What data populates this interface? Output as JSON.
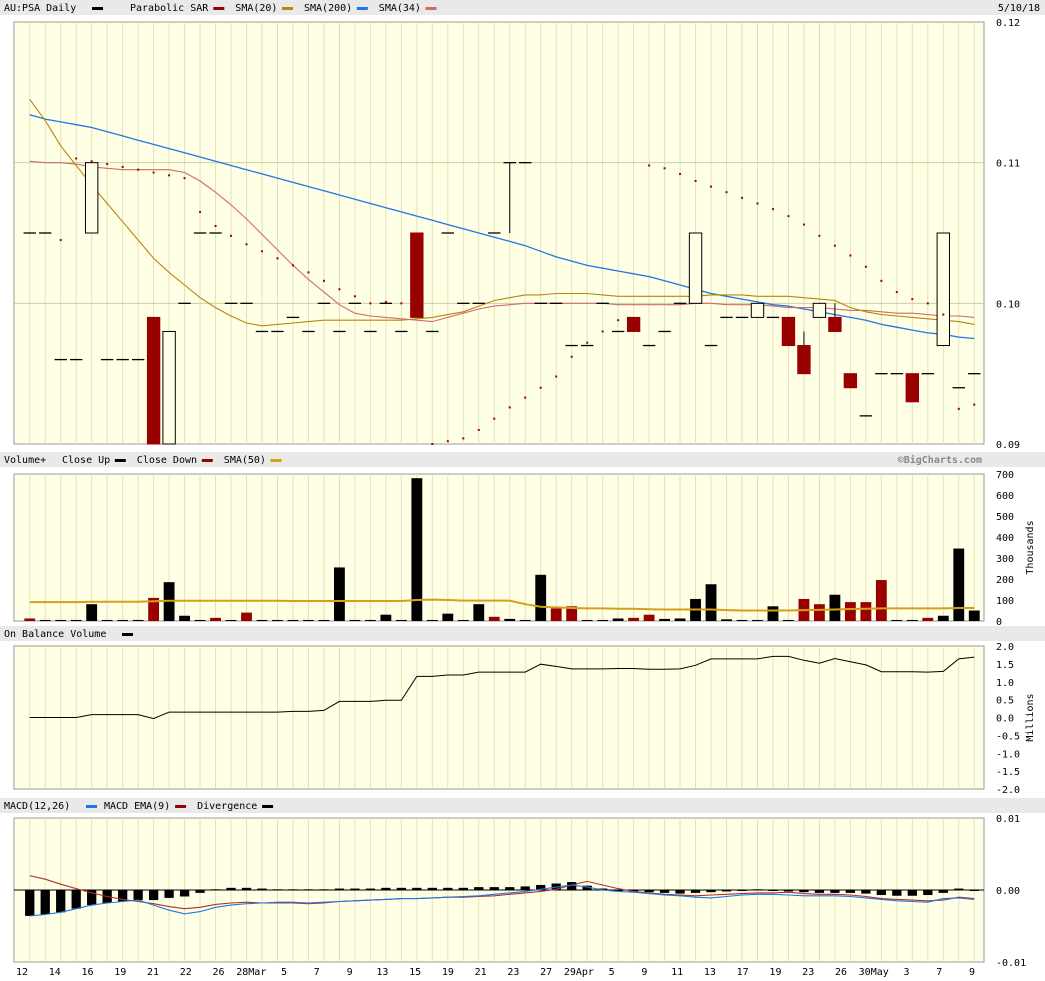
{
  "header": {
    "symbol": "AU:PSA Daily",
    "date": "5/10/18",
    "watermark": "©BigCharts.com"
  },
  "colors": {
    "panel_bg": "#ffffe6",
    "grid": "#e2e2b8",
    "up": "#000000",
    "down": "#990000",
    "sma20": "#b8860b",
    "sma200": "#1f77e6",
    "sma34": "#d06b6b",
    "volsma": "#d4a017"
  },
  "chart_data": [
    {
      "type": "candlestick",
      "title": "AU:PSA Daily",
      "legend": [
        {
          "name": "Parabolic SAR",
          "color": "#990000"
        },
        {
          "name": "SMA(20)",
          "color": "#b8860b"
        },
        {
          "name": "SMA(200)",
          "color": "#1f77e6"
        },
        {
          "name": "SMA(34)",
          "color": "#d06b6b"
        }
      ],
      "ylim": [
        0.09,
        0.12
      ],
      "yticks": [
        "0.12",
        "0.11",
        "0.10",
        "0.09"
      ],
      "x_tick_labels": [
        "12",
        "14",
        "16",
        "19",
        "21",
        "22",
        "26",
        "28Mar",
        "5",
        "7",
        "9",
        "13",
        "15",
        "19",
        "21",
        "23",
        "27",
        "29Apr",
        "5",
        "9",
        "11",
        "13",
        "17",
        "19",
        "23",
        "26",
        "30May",
        "3",
        "7",
        "9"
      ],
      "candles": [
        {
          "o": 0.105,
          "h": 0.105,
          "l": 0.105,
          "c": 0.105
        },
        {
          "o": 0.105,
          "h": 0.105,
          "l": 0.105,
          "c": 0.105
        },
        {
          "o": 0.096,
          "h": 0.096,
          "l": 0.096,
          "c": 0.096
        },
        {
          "o": 0.096,
          "h": 0.096,
          "l": 0.096,
          "c": 0.096
        },
        {
          "o": 0.105,
          "h": 0.11,
          "l": 0.105,
          "c": 0.11
        },
        {
          "o": 0.096,
          "h": 0.096,
          "l": 0.096,
          "c": 0.096
        },
        {
          "o": 0.096,
          "h": 0.096,
          "l": 0.096,
          "c": 0.096
        },
        {
          "o": 0.096,
          "h": 0.096,
          "l": 0.096,
          "c": 0.096
        },
        {
          "o": 0.099,
          "h": 0.099,
          "l": 0.09,
          "c": 0.09
        },
        {
          "o": 0.09,
          "h": 0.098,
          "l": 0.09,
          "c": 0.098
        },
        {
          "o": 0.1,
          "h": 0.1,
          "l": 0.1,
          "c": 0.1
        },
        {
          "o": 0.105,
          "h": 0.105,
          "l": 0.105,
          "c": 0.105
        },
        {
          "o": 0.105,
          "h": 0.105,
          "l": 0.105,
          "c": 0.105
        },
        {
          "o": 0.1,
          "h": 0.1,
          "l": 0.1,
          "c": 0.1
        },
        {
          "o": 0.1,
          "h": 0.1,
          "l": 0.1,
          "c": 0.1
        },
        {
          "o": 0.098,
          "h": 0.098,
          "l": 0.098,
          "c": 0.098
        },
        {
          "o": 0.098,
          "h": 0.098,
          "l": 0.098,
          "c": 0.098
        },
        {
          "o": 0.099,
          "h": 0.099,
          "l": 0.099,
          "c": 0.099
        },
        {
          "o": 0.098,
          "h": 0.098,
          "l": 0.098,
          "c": 0.098
        },
        {
          "o": 0.1,
          "h": 0.1,
          "l": 0.1,
          "c": 0.1
        },
        {
          "o": 0.098,
          "h": 0.098,
          "l": 0.098,
          "c": 0.098
        },
        {
          "o": 0.1,
          "h": 0.1,
          "l": 0.1,
          "c": 0.1
        },
        {
          "o": 0.098,
          "h": 0.098,
          "l": 0.098,
          "c": 0.098
        },
        {
          "o": 0.1,
          "h": 0.1,
          "l": 0.1,
          "c": 0.1
        },
        {
          "o": 0.098,
          "h": 0.098,
          "l": 0.098,
          "c": 0.098
        },
        {
          "o": 0.105,
          "h": 0.105,
          "l": 0.099,
          "c": 0.099
        },
        {
          "o": 0.098,
          "h": 0.098,
          "l": 0.098,
          "c": 0.098
        },
        {
          "o": 0.105,
          "h": 0.105,
          "l": 0.105,
          "c": 0.105
        },
        {
          "o": 0.1,
          "h": 0.1,
          "l": 0.1,
          "c": 0.1
        },
        {
          "o": 0.1,
          "h": 0.1,
          "l": 0.1,
          "c": 0.1
        },
        {
          "o": 0.105,
          "h": 0.105,
          "l": 0.105,
          "c": 0.105
        },
        {
          "o": 0.11,
          "h": 0.11,
          "l": 0.105,
          "c": 0.11
        },
        {
          "o": 0.11,
          "h": 0.11,
          "l": 0.11,
          "c": 0.11
        },
        {
          "o": 0.1,
          "h": 0.1,
          "l": 0.1,
          "c": 0.1
        },
        {
          "o": 0.1,
          "h": 0.1,
          "l": 0.1,
          "c": 0.1
        },
        {
          "o": 0.097,
          "h": 0.097,
          "l": 0.097,
          "c": 0.097
        },
        {
          "o": 0.097,
          "h": 0.097,
          "l": 0.097,
          "c": 0.097
        },
        {
          "o": 0.1,
          "h": 0.1,
          "l": 0.1,
          "c": 0.1
        },
        {
          "o": 0.098,
          "h": 0.098,
          "l": 0.098,
          "c": 0.098
        },
        {
          "o": 0.099,
          "h": 0.099,
          "l": 0.098,
          "c": 0.098
        },
        {
          "o": 0.097,
          "h": 0.097,
          "l": 0.097,
          "c": 0.097
        },
        {
          "o": 0.098,
          "h": 0.098,
          "l": 0.098,
          "c": 0.098
        },
        {
          "o": 0.1,
          "h": 0.1,
          "l": 0.1,
          "c": 0.1
        },
        {
          "o": 0.1,
          "h": 0.105,
          "l": 0.1,
          "c": 0.105
        },
        {
          "o": 0.097,
          "h": 0.097,
          "l": 0.097,
          "c": 0.097
        },
        {
          "o": 0.099,
          "h": 0.099,
          "l": 0.099,
          "c": 0.099
        },
        {
          "o": 0.099,
          "h": 0.099,
          "l": 0.099,
          "c": 0.099
        },
        {
          "o": 0.099,
          "h": 0.1,
          "l": 0.099,
          "c": 0.1
        },
        {
          "o": 0.099,
          "h": 0.099,
          "l": 0.099,
          "c": 0.099
        },
        {
          "o": 0.099,
          "h": 0.099,
          "l": 0.097,
          "c": 0.097
        },
        {
          "o": 0.097,
          "h": 0.098,
          "l": 0.095,
          "c": 0.095
        },
        {
          "o": 0.099,
          "h": 0.1,
          "l": 0.099,
          "c": 0.1
        },
        {
          "o": 0.099,
          "h": 0.1,
          "l": 0.098,
          "c": 0.098
        },
        {
          "o": 0.095,
          "h": 0.095,
          "l": 0.094,
          "c": 0.094
        },
        {
          "o": 0.092,
          "h": 0.092,
          "l": 0.092,
          "c": 0.092
        },
        {
          "o": 0.095,
          "h": 0.095,
          "l": 0.095,
          "c": 0.095
        },
        {
          "o": 0.095,
          "h": 0.095,
          "l": 0.095,
          "c": 0.095
        },
        {
          "o": 0.095,
          "h": 0.095,
          "l": 0.093,
          "c": 0.093
        },
        {
          "o": 0.095,
          "h": 0.095,
          "l": 0.095,
          "c": 0.095
        },
        {
          "o": 0.097,
          "h": 0.105,
          "l": 0.097,
          "c": 0.105
        },
        {
          "o": 0.094,
          "h": 0.094,
          "l": 0.094,
          "c": 0.094
        },
        {
          "o": 0.095,
          "h": 0.095,
          "l": 0.095,
          "c": 0.095
        }
      ],
      "sar": [
        null,
        null,
        0.1045,
        0.1103,
        0.1101,
        0.1099,
        0.1097,
        0.1095,
        0.1093,
        0.1091,
        0.1089,
        0.1065,
        0.1055,
        0.1048,
        0.1042,
        0.1037,
        0.1032,
        0.1027,
        0.1022,
        0.1016,
        0.101,
        0.1005,
        0.1,
        0.1001,
        0.1,
        null,
        0.09,
        0.0902,
        0.0904,
        0.091,
        0.0918,
        0.0926,
        0.0933,
        0.094,
        0.0948,
        0.0962,
        0.0972,
        0.098,
        0.0988,
        null,
        0.1098,
        0.1096,
        0.1092,
        0.1087,
        0.1083,
        0.1079,
        0.1075,
        0.1071,
        0.1067,
        0.1062,
        0.1056,
        0.1048,
        0.1041,
        0.1034,
        0.1026,
        0.1016,
        0.1008,
        0.1003,
        0.1,
        0.0992,
        0.0925,
        0.0928
      ],
      "sma200": [
        0.1134,
        0.1131,
        0.1129,
        0.1127,
        0.1125,
        0.1122,
        0.1119,
        0.1116,
        0.1113,
        0.111,
        0.1107,
        0.1104,
        0.1101,
        0.1098,
        0.1095,
        0.1092,
        0.1089,
        0.1086,
        0.1083,
        0.108,
        0.1077,
        0.1074,
        0.1071,
        0.1068,
        0.1065,
        0.1062,
        0.1059,
        0.1056,
        0.1053,
        0.105,
        0.1047,
        0.1044,
        0.1041,
        0.1037,
        0.1033,
        0.103,
        0.1027,
        0.1025,
        0.1023,
        0.1021,
        0.1019,
        0.1016,
        0.1013,
        0.101,
        0.1007,
        0.1005,
        0.1003,
        0.1001,
        0.0999,
        0.0998,
        0.0996,
        0.0994,
        0.0992,
        0.099,
        0.0988,
        0.0985,
        0.0983,
        0.0981,
        0.0979,
        0.0978,
        0.0976,
        0.0975
      ],
      "sma20": [
        0.1145,
        0.113,
        0.1112,
        0.1098,
        0.1084,
        0.1071,
        0.1058,
        0.1045,
        0.1032,
        0.1022,
        0.1013,
        0.1004,
        0.0997,
        0.0991,
        0.0986,
        0.0984,
        0.0985,
        0.0986,
        0.0987,
        0.0988,
        0.0988,
        0.0988,
        0.0988,
        0.0988,
        0.0988,
        0.0989,
        0.099,
        0.0992,
        0.0994,
        0.0998,
        0.1002,
        0.1004,
        0.1006,
        0.1006,
        0.1007,
        0.1007,
        0.1007,
        0.1006,
        0.1005,
        0.1005,
        0.1005,
        0.1005,
        0.1005,
        0.1005,
        0.1006,
        0.1006,
        0.1006,
        0.1005,
        0.1005,
        0.1005,
        0.1004,
        0.1003,
        0.1002,
        0.0997,
        0.0994,
        0.0992,
        0.0991,
        0.099,
        0.0989,
        0.0988,
        0.0987,
        0.0985
      ],
      "sma34": [
        0.1101,
        0.11,
        0.11,
        0.1099,
        0.1097,
        0.1096,
        0.1095,
        0.1095,
        0.1095,
        0.1095,
        0.1093,
        0.1087,
        0.1079,
        0.107,
        0.106,
        0.1049,
        0.1038,
        0.1027,
        0.1017,
        0.1008,
        0.0999,
        0.0993,
        0.0991,
        0.099,
        0.0989,
        0.0988,
        0.0987,
        0.099,
        0.0993,
        0.0996,
        0.0998,
        0.0999,
        0.1,
        0.1,
        0.1,
        0.1,
        0.1,
        0.1,
        0.0999,
        0.0999,
        0.0999,
        0.0999,
        0.0999,
        0.1,
        0.1,
        0.0999,
        0.0999,
        0.0999,
        0.0998,
        0.0997,
        0.0997,
        0.0997,
        0.0996,
        0.0995,
        0.0995,
        0.0994,
        0.0993,
        0.0993,
        0.0992,
        0.0991,
        0.0991,
        0.099
      ]
    },
    {
      "type": "bar",
      "title": "Volume+",
      "legend": [
        {
          "name": "Close Up",
          "color": "#000000"
        },
        {
          "name": "Close Down",
          "color": "#990000"
        },
        {
          "name": "SMA(50)",
          "color": "#d4a017"
        }
      ],
      "ylabel": "Thousands",
      "ylim": [
        0,
        700
      ],
      "yticks": [
        "700",
        "600",
        "500",
        "400",
        "300",
        "200",
        "100",
        "0"
      ],
      "values": [
        12,
        5,
        5,
        5,
        80,
        5,
        5,
        5,
        110,
        185,
        25,
        5,
        15,
        5,
        40,
        5,
        5,
        5,
        5,
        5,
        255,
        5,
        5,
        30,
        5,
        680,
        5,
        35,
        5,
        80,
        20,
        10,
        5,
        220,
        60,
        70,
        5,
        5,
        12,
        15,
        30,
        10,
        12,
        105,
        175,
        8,
        5,
        5,
        70,
        5,
        105,
        80,
        125,
        90,
        90,
        195,
        5,
        5,
        15,
        25,
        345,
        50
      ],
      "down": [
        1,
        0,
        0,
        0,
        0,
        0,
        0,
        0,
        1,
        0,
        0,
        0,
        1,
        0,
        1,
        0,
        0,
        0,
        0,
        0,
        0,
        0,
        0,
        0,
        0,
        0,
        0,
        0,
        0,
        0,
        1,
        0,
        0,
        0,
        1,
        1,
        0,
        0,
        0,
        1,
        1,
        0,
        0,
        0,
        0,
        0,
        0,
        0,
        0,
        0,
        1,
        1,
        0,
        1,
        1,
        1,
        0,
        0,
        1,
        0,
        0,
        0
      ],
      "sma": [
        90,
        90,
        90,
        90,
        92,
        92,
        92,
        92,
        94,
        96,
        96,
        96,
        96,
        96,
        96,
        96,
        96,
        95,
        95,
        95,
        95,
        95,
        95,
        95,
        95,
        100,
        102,
        100,
        97,
        97,
        97,
        97,
        80,
        68,
        65,
        62,
        60,
        60,
        58,
        58,
        56,
        55,
        55,
        55,
        55,
        52,
        50,
        50,
        50,
        50,
        52,
        53,
        55,
        57,
        58,
        60,
        60,
        60,
        60,
        60,
        62,
        62
      ]
    },
    {
      "type": "line",
      "title": "On Balance Volume",
      "ylabel": "Millions",
      "ylim": [
        -2.0,
        2.0
      ],
      "yticks": [
        "2.0",
        "1.5",
        "1.0",
        "0.5",
        "0.0",
        "-0.5",
        "-1.0",
        "-1.5",
        "-2.0"
      ],
      "values": [
        0.0,
        0.0,
        0.0,
        0.0,
        0.08,
        0.08,
        0.08,
        0.08,
        -0.03,
        0.15,
        0.15,
        0.15,
        0.15,
        0.15,
        0.15,
        0.15,
        0.15,
        0.17,
        0.17,
        0.2,
        0.45,
        0.45,
        0.45,
        0.48,
        0.48,
        1.15,
        1.15,
        1.19,
        1.19,
        1.27,
        1.27,
        1.27,
        1.27,
        1.49,
        1.43,
        1.36,
        1.36,
        1.36,
        1.37,
        1.37,
        1.35,
        1.35,
        1.36,
        1.46,
        1.64,
        1.64,
        1.64,
        1.64,
        1.71,
        1.71,
        1.6,
        1.52,
        1.65,
        1.56,
        1.47,
        1.28,
        1.28,
        1.28,
        1.27,
        1.29,
        1.64,
        1.69
      ]
    },
    {
      "type": "bar",
      "title": "MACD(12,26)",
      "legend": [
        {
          "name": "MACD EMA(9)",
          "color": "#1f77e6"
        },
        {
          "name": "Divergence",
          "color": "#000000"
        }
      ],
      "ylim": [
        -0.01,
        0.01
      ],
      "yticks": [
        "0.01",
        "0.00",
        "-0.01"
      ],
      "divergence": [
        -0.0036,
        -0.0034,
        -0.0031,
        -0.0026,
        -0.0021,
        -0.0018,
        -0.0016,
        -0.0014,
        -0.0014,
        -0.0011,
        -0.0009,
        -0.0004,
        0.0001,
        0.0003,
        0.0003,
        0.0002,
        0.0001,
        0.0001,
        0.0001,
        0.0001,
        0.0002,
        0.0002,
        0.0002,
        0.0003,
        0.0003,
        0.0003,
        0.0003,
        0.0003,
        0.0003,
        0.0004,
        0.0004,
        0.0004,
        0.0005,
        0.0007,
        0.0009,
        0.0011,
        0.0006,
        0.0002,
        -0.0001,
        -0.0002,
        -0.0003,
        -0.0004,
        -0.0005,
        -0.0004,
        -0.0003,
        -0.0002,
        -0.0001,
        0.0001,
        -0.0001,
        -0.0002,
        -0.0003,
        -0.0004,
        -0.0004,
        -0.0004,
        -0.0005,
        -0.0007,
        -0.0008,
        -0.0008,
        -0.0007,
        -0.0004,
        0.0002,
        -0.0001
      ],
      "macd": [
        0.002,
        0.0015,
        0.0008,
        0.0002,
        -0.0004,
        -0.0009,
        -0.0013,
        -0.0016,
        -0.0019,
        -0.0023,
        -0.0026,
        -0.0024,
        -0.002,
        -0.0018,
        -0.0017,
        -0.0018,
        -0.0018,
        -0.0018,
        -0.0019,
        -0.0018,
        -0.0016,
        -0.0015,
        -0.0014,
        -0.0013,
        -0.0012,
        -0.0012,
        -0.0011,
        -0.001,
        -0.001,
        -0.0009,
        -0.0008,
        -0.0006,
        -0.0004,
        -0.0002,
        0.0001,
        0.0007,
        0.0012,
        0.0007,
        0.0002,
        -0.0002,
        -0.0004,
        -0.0006,
        -0.0007,
        -0.0008,
        -0.0007,
        -0.0006,
        -0.0005,
        -0.0004,
        -0.0004,
        -0.0003,
        -0.0005,
        -0.0006,
        -0.0006,
        -0.0007,
        -0.0009,
        -0.0012,
        -0.0013,
        -0.0014,
        -0.0015,
        -0.0014,
        -0.001,
        -0.0012
      ],
      "ema": [
        -0.0036,
        -0.0034,
        -0.0031,
        -0.0026,
        -0.0021,
        -0.0018,
        -0.0016,
        -0.0014,
        -0.0021,
        -0.0028,
        -0.0033,
        -0.003,
        -0.0024,
        -0.0021,
        -0.0019,
        -0.0018,
        -0.0017,
        -0.0017,
        -0.0018,
        -0.0017,
        -0.0016,
        -0.0015,
        -0.0014,
        -0.0013,
        -0.0012,
        -0.0012,
        -0.0011,
        -0.001,
        -0.0009,
        -0.0008,
        -0.0006,
        -0.0004,
        -0.0002,
        0.0001,
        0.0004,
        0.0007,
        0.0004,
        0.0,
        -0.0002,
        -0.0003,
        -0.0005,
        -0.0007,
        -0.0008,
        -0.001,
        -0.0011,
        -0.0009,
        -0.0007,
        -0.0006,
        -0.0006,
        -0.0007,
        -0.0008,
        -0.0008,
        -0.0008,
        -0.0009,
        -0.0011,
        -0.0013,
        -0.0015,
        -0.0016,
        -0.0017,
        -0.0012,
        -0.0011,
        -0.0013
      ]
    }
  ]
}
